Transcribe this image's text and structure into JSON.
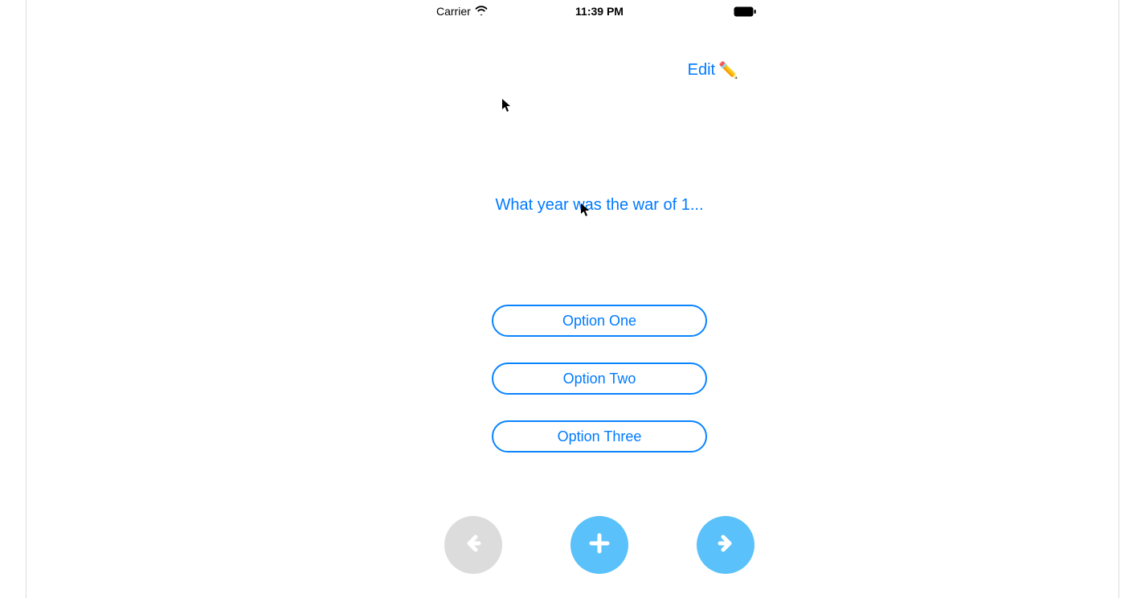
{
  "statusbar": {
    "carrier": "Carrier",
    "time": "11:39 PM"
  },
  "nav": {
    "edit_label": "Edit",
    "edit_icon": "✏️"
  },
  "question": {
    "text": "What year was the war of 1..."
  },
  "options": [
    {
      "label": "Option One"
    },
    {
      "label": "Option Two"
    },
    {
      "label": "Option Three"
    }
  ],
  "colors": {
    "ios_blue": "#007aff",
    "border_blue": "#0a84ff",
    "button_active": "#5ac1fa",
    "button_disabled": "#dcdcdc"
  }
}
